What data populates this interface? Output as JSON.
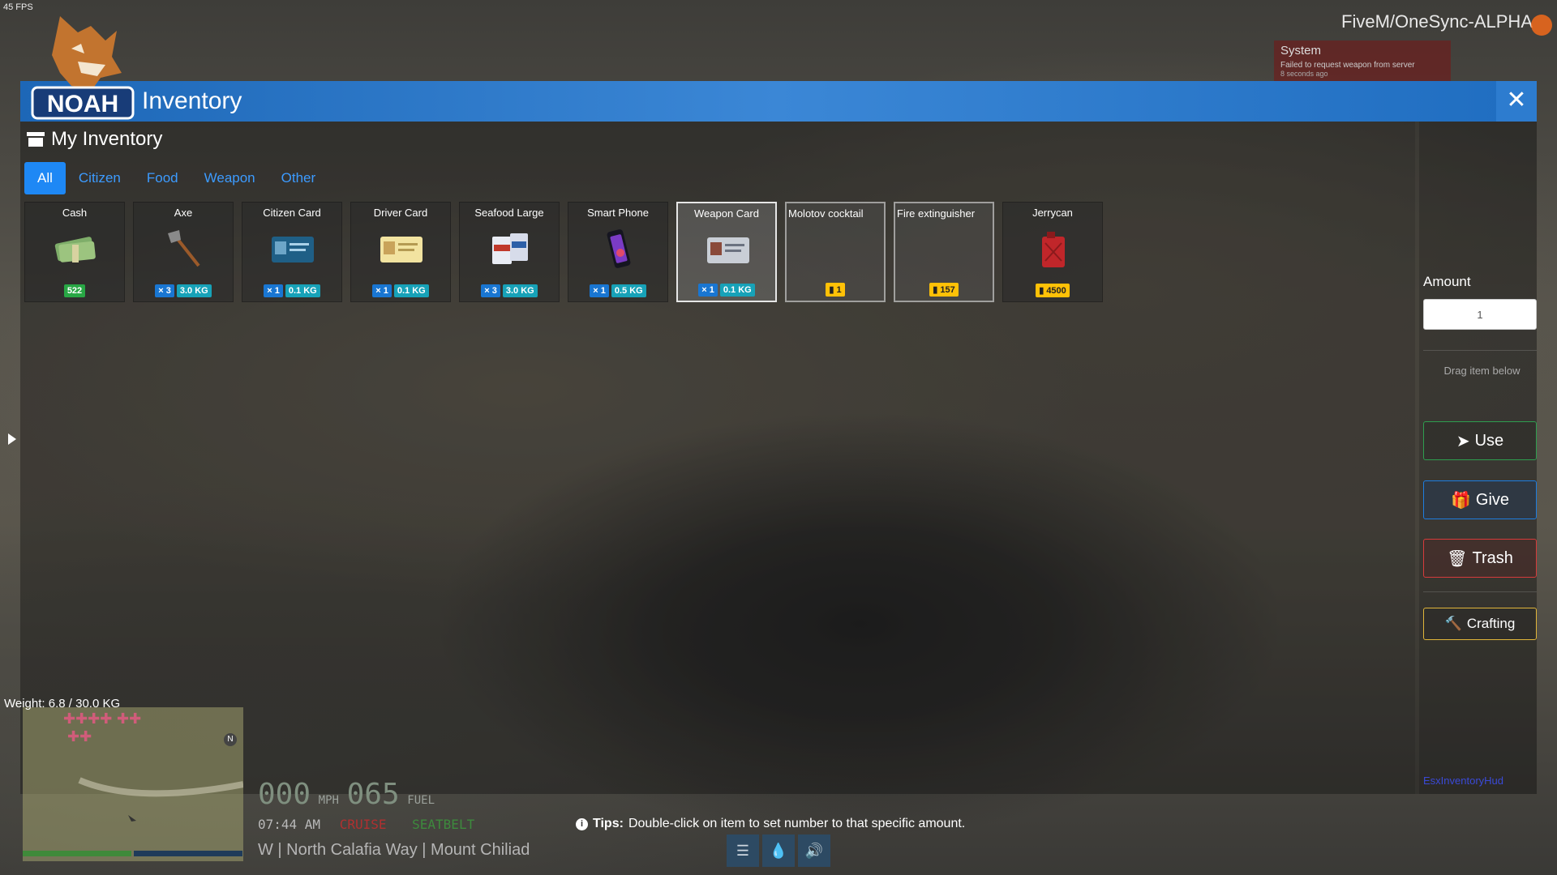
{
  "hud_top": {
    "fps": "45 FPS",
    "server": "FiveM/OneSync-ALPHA"
  },
  "notification": {
    "title": "System",
    "text": "Failed to request weapon from server",
    "time": "8 seconds ago"
  },
  "logo": {
    "text": "NOAH"
  },
  "window": {
    "title": "Inventory",
    "close_label": "✕",
    "section_title": "My Inventory",
    "tabs": [
      {
        "label": "All",
        "active": true
      },
      {
        "label": "Citizen",
        "active": false
      },
      {
        "label": "Food",
        "active": false
      },
      {
        "label": "Weapon",
        "active": false
      },
      {
        "label": "Other",
        "active": false
      }
    ],
    "items": [
      {
        "name": "Cash",
        "count": "522",
        "weight": "",
        "icon": "cash-icon"
      },
      {
        "name": "Axe",
        "count": "× 3",
        "weight": "3.0 KG",
        "icon": "axe-icon"
      },
      {
        "name": "Citizen Card",
        "count": "× 1",
        "weight": "0.1 KG",
        "icon": "id-card-icon"
      },
      {
        "name": "Driver Card",
        "count": "× 1",
        "weight": "0.1 KG",
        "icon": "driver-card-icon"
      },
      {
        "name": "Seafood Large",
        "count": "× 3",
        "weight": "3.0 KG",
        "icon": "food-pack-icon"
      },
      {
        "name": "Smart Phone",
        "count": "× 1",
        "weight": "0.5 KG",
        "icon": "phone-icon"
      },
      {
        "name": "Weapon Card",
        "count": "× 1",
        "weight": "0.1 KG",
        "icon": "weapon-card-icon"
      },
      {
        "name": "Molotov cocktail",
        "count": "1",
        "weight": "",
        "icon": "broken-image"
      },
      {
        "name": "Fire extinguisher",
        "count": "157",
        "weight": "",
        "icon": "broken-image"
      },
      {
        "name": "Jerrycan",
        "count": "4500",
        "weight": "",
        "icon": "jerrycan-icon"
      }
    ],
    "weight_label": "Weight: 6.8 / 30.0 KG"
  },
  "side_panel": {
    "amount_label": "Amount",
    "amount_value": "1",
    "drag_hint": "Drag item below",
    "use_label": "Use",
    "give_label": "Give",
    "trash_label": "Trash",
    "crafting_label": "Crafting",
    "footer": "EsxInventoryHud"
  },
  "tips": {
    "label": "Tips:",
    "text": "Double-click on item to set number to that specific amount."
  },
  "vehicle_hud": {
    "speed": "000",
    "speed_unit": "MPH",
    "fuel": "065",
    "fuel_unit": "FUEL",
    "time": "07:44 AM",
    "cruise": "CRUISE",
    "seatbelt": "SEATBELT",
    "street": "W | North Calafia Way | Mount Chiliad"
  },
  "minimap": {
    "north": "N"
  },
  "colors": {
    "accent": "#1e88f5",
    "titlebar": "#3b87d6",
    "use": "#2e9e4f",
    "give": "#1d7de0",
    "trash": "#d63b3b",
    "craft": "#e0b53a",
    "cruise": "#b03030",
    "seatbelt": "#3d8a3d"
  }
}
